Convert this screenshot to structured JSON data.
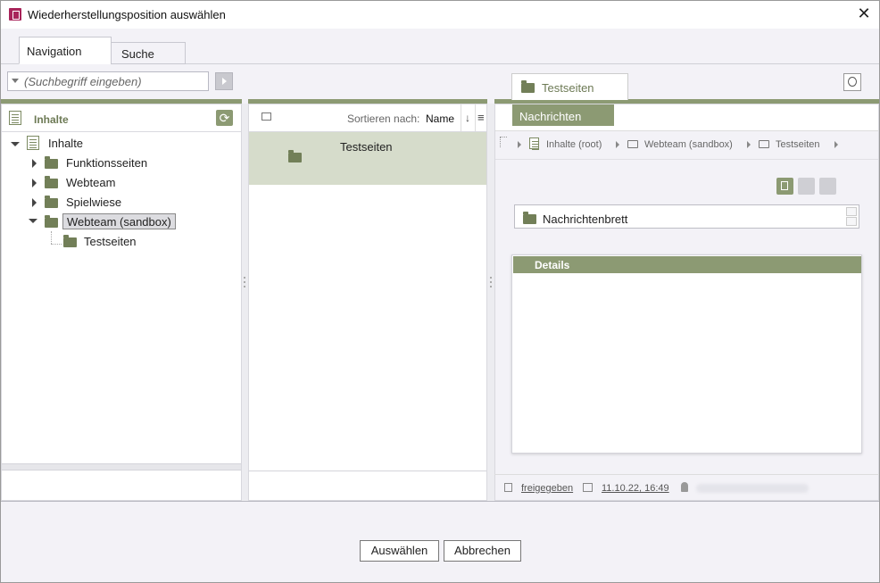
{
  "window": {
    "title": "Wiederherstellungsposition auswählen",
    "close_glyph": "✕"
  },
  "tabs": [
    {
      "label": "Navigation",
      "active": true
    },
    {
      "label": "Suche",
      "active": false
    }
  ],
  "search": {
    "placeholder": "(Suchbegriff eingeben)"
  },
  "left_panel": {
    "title": "Inhalte",
    "tree": [
      {
        "label": "Inhalte",
        "level": 0,
        "expanded": true,
        "icon": "document-icon"
      },
      {
        "label": "Funktionsseiten",
        "level": 1,
        "expanded": false,
        "icon": "folder-icon"
      },
      {
        "label": "Webteam",
        "level": 1,
        "expanded": false,
        "icon": "folder-icon"
      },
      {
        "label": "Spielwiese",
        "level": 1,
        "expanded": false,
        "icon": "folder-icon"
      },
      {
        "label": "Webteam (sandbox)",
        "level": 1,
        "expanded": true,
        "selected": true,
        "icon": "folder-icon"
      },
      {
        "label": "Testseiten",
        "level": 2,
        "icon": "folder-icon"
      }
    ]
  },
  "middle_panel": {
    "sort_label": "Sortieren nach:",
    "sort_value": "Name",
    "sort_dir_glyph": "↓",
    "menu_glyph": "≡",
    "items": [
      {
        "label": "Testseiten",
        "selected": true
      }
    ]
  },
  "right_panel": {
    "tab_label": "Testseiten",
    "subtab_label": "Nachrichten",
    "breadcrumb": [
      "Inhalte (root)",
      "Webteam (sandbox)",
      "Testseiten"
    ],
    "list_item": "Nachrichtenbrett",
    "details_title": "Details",
    "footer": {
      "status": "freigegeben",
      "date": "11.10.22, 16:49"
    }
  },
  "buttons": {
    "select": "Auswählen",
    "cancel": "Abbrechen"
  },
  "colors": {
    "accent": "#8c9a73",
    "folder": "#727f58",
    "selected_bg": "#d6dccb"
  }
}
